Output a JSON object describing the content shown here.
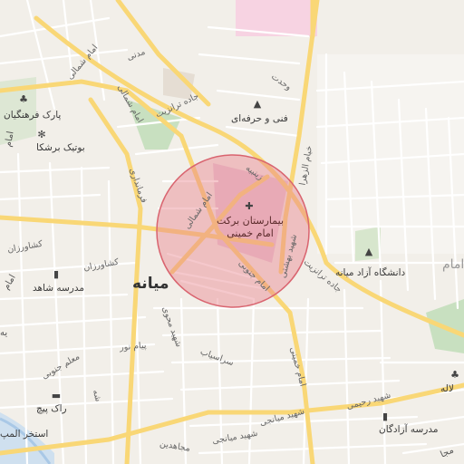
{
  "map": {
    "city_label": "میانه",
    "highlight_circle": {
      "fill": "#e8848f",
      "stroke": "#d9646f"
    },
    "colors": {
      "land": "#f2efe9",
      "major_road": "#f9d776",
      "minor_road": "#ffffff",
      "park": "#c8e0c0",
      "hospital_area": "#e8c8d8",
      "water": "#a9c8e6"
    },
    "pois": {
      "hospital": {
        "name_line1": "بیمارستان برکت",
        "name_line2": "امام خمینی",
        "icon": "hospital-cross-icon"
      },
      "park_cultural": {
        "name": "پارک فرهنگیان",
        "icon": "tree-icon"
      },
      "boutique": {
        "name": "بوتیک برشکا",
        "icon": "clothing-icon"
      },
      "tech_school": {
        "name": "فنی و حرفه‌ای",
        "icon": "graduation-cap-icon"
      },
      "azad_university": {
        "name": "دانشگاه آزاد میانه",
        "icon": "graduation-cap-icon"
      },
      "shahed_school": {
        "name": "مدرسه شاهد",
        "icon": "school-icon"
      },
      "azadegan_school": {
        "name": "مدرسه آزادگان",
        "icon": "school-icon"
      },
      "rak_pich": {
        "name": "راک پیچ",
        "icon": "car-icon"
      },
      "pool": {
        "name": "استخر المپ",
        "icon": "pool-icon"
      },
      "laleh": {
        "name": "لاله",
        "icon": "tree-icon"
      }
    },
    "roads": {
      "jadeh_tranzit_1": "جاده ترانزیت",
      "jadeh_tranzit_2": "جاده ترانزیت",
      "imam_shomali_1": "امام شمالی",
      "imam_shomali_2": "امام شمالی",
      "imam_shomali_3": "امام شمالی",
      "imam_jonoubi": "امام جنوبی",
      "farmandari": "فرمانداری",
      "keshavarzan_1": "کشاورزان",
      "keshavarzan_2": "کشاورزان",
      "madani": "مدنی",
      "vahdat": "وحدت",
      "zeinabieh": "زینبیه",
      "alzahra": "خیام الزهرا",
      "shahid_bahshti": "شهید بهشتی",
      "emam_khomeini": "امام خمینی",
      "payam_nour": "پیام نور",
      "sarasiab": "سراسیاب",
      "shahid_mahvi": "شهید محوی",
      "moalem_jonoubi": "معلم جنوبی",
      "shahid_rahimi": "شهید رحیمی",
      "shahid_miyanji_1": "شهید میانجی",
      "shahid_miyanji_2": "شهید میانجی",
      "mojahedin": "مجاهدین",
      "shahid_partial": "شه"
    },
    "edge_labels": {
      "left_1": "امام",
      "left_2": "امام",
      "bottom_left": "یه",
      "right_top": "امام",
      "right_bottom": "مجا"
    }
  }
}
